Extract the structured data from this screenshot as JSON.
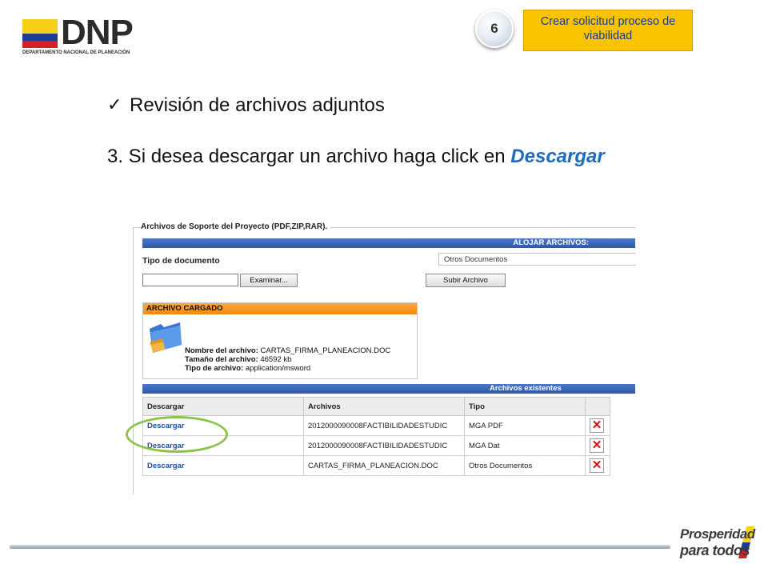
{
  "header": {
    "logo_text": "DNP",
    "logo_subtitle": "DEPARTAMENTO NACIONAL DE PLANEACIÓN",
    "step_number": "6",
    "process_title": "Crear solicitud proceso de viabilidad"
  },
  "content": {
    "bullet_text": "Revisión de archivos adjuntos",
    "instruction_prefix": "3. Si desea descargar un archivo haga click en ",
    "instruction_emphasis": "Descargar"
  },
  "panel": {
    "fieldset_title": "Archivos de Soporte del Proyecto (PDF,ZIP,RAR).",
    "upload_bar": "ALOJAR ARCHIVOS:",
    "doc_type_label": "Tipo de documento",
    "doc_type_value": "Otros Documentos",
    "browse_button": "Examinar...",
    "upload_button": "Subir Archivo",
    "uploaded_header": "ARCHIVO CARGADO",
    "file_name_label": "Nombre del archivo:",
    "file_name_value": "CARTAS_FIRMA_PLANEACION.DOC",
    "file_size_label": "Tamaño del archivo:",
    "file_size_value": "46592 kb",
    "file_type_label": "Tipo de archivo:",
    "file_type_value": "application/msword",
    "existing_bar": "Archivos existentes",
    "table": {
      "headers": [
        "Descargar",
        "Archivos",
        "Tipo"
      ],
      "rows": [
        {
          "download": "Descargar",
          "file": "2012000090008FACTIBILIDADESTUDIC",
          "type": "MGA PDF"
        },
        {
          "download": "Descargar",
          "file": "2012000090008FACTIBILIDADESTUDIC",
          "type": "MGA Dat"
        },
        {
          "download": "Descargar",
          "file": "CARTAS_FIRMA_PLANEACION.DOC",
          "type": "Otros Documentos"
        }
      ]
    }
  },
  "footer": {
    "brand_line1": "Prosperidad",
    "brand_line2": "para todos"
  },
  "colors": {
    "accent_yellow": "#f8c400",
    "link_blue": "#1f6bbf",
    "highlight_green": "#8bc34a",
    "bar_blue": "#2d58a8",
    "bar_orange": "#f08a10"
  }
}
